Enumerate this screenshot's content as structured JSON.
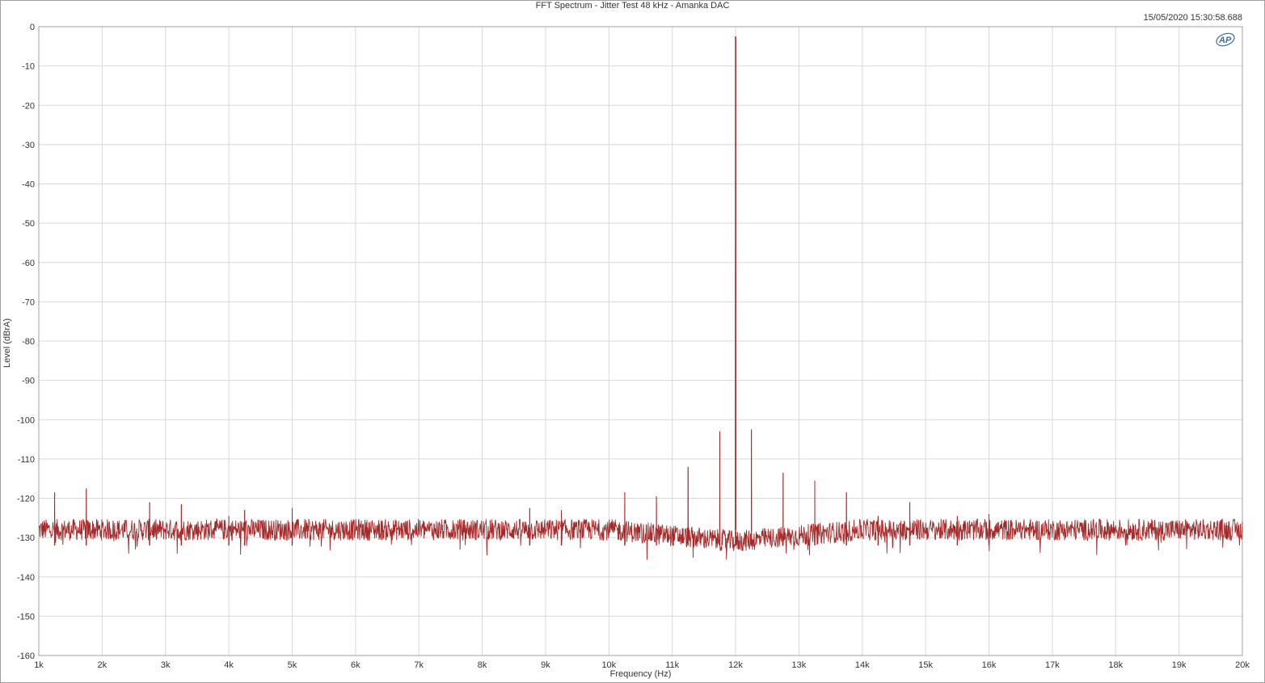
{
  "chart_data": {
    "type": "line",
    "title": "FFT Spectrum - Jitter Test 48 kHz - Amanka DAC",
    "timestamp": "15/05/2020 15:30:58.688",
    "xlabel": "Frequency (Hz)",
    "ylabel": "Level (dBrA)",
    "xlim": [
      1000,
      20000
    ],
    "ylim": [
      -160,
      0
    ],
    "x_ticks": [
      {
        "value": 1000,
        "label": "1k"
      },
      {
        "value": 2000,
        "label": "2k"
      },
      {
        "value": 3000,
        "label": "3k"
      },
      {
        "value": 4000,
        "label": "4k"
      },
      {
        "value": 5000,
        "label": "5k"
      },
      {
        "value": 6000,
        "label": "6k"
      },
      {
        "value": 7000,
        "label": "7k"
      },
      {
        "value": 8000,
        "label": "8k"
      },
      {
        "value": 9000,
        "label": "9k"
      },
      {
        "value": 10000,
        "label": "10k"
      },
      {
        "value": 11000,
        "label": "11k"
      },
      {
        "value": 12000,
        "label": "12k"
      },
      {
        "value": 13000,
        "label": "13k"
      },
      {
        "value": 14000,
        "label": "14k"
      },
      {
        "value": 15000,
        "label": "15k"
      },
      {
        "value": 16000,
        "label": "16k"
      },
      {
        "value": 17000,
        "label": "17k"
      },
      {
        "value": 18000,
        "label": "18k"
      },
      {
        "value": 19000,
        "label": "19k"
      },
      {
        "value": 20000,
        "label": "20k"
      }
    ],
    "y_ticks": [
      {
        "value": 0,
        "label": "0"
      },
      {
        "value": -10,
        "label": "-10"
      },
      {
        "value": -20,
        "label": "-20"
      },
      {
        "value": -30,
        "label": "-30"
      },
      {
        "value": -40,
        "label": "-40"
      },
      {
        "value": -50,
        "label": "-50"
      },
      {
        "value": -60,
        "label": "-60"
      },
      {
        "value": -70,
        "label": "-70"
      },
      {
        "value": -80,
        "label": "-80"
      },
      {
        "value": -90,
        "label": "-90"
      },
      {
        "value": -100,
        "label": "-100"
      },
      {
        "value": -110,
        "label": "-110"
      },
      {
        "value": -120,
        "label": "-120"
      },
      {
        "value": -130,
        "label": "-130"
      },
      {
        "value": -140,
        "label": "-140"
      },
      {
        "value": -150,
        "label": "-150"
      },
      {
        "value": -160,
        "label": "-160"
      }
    ],
    "grid": true,
    "series_color": "#a52a2a",
    "noise_floor_db": -128,
    "noise_floor_db_near_12k": -131,
    "peaks": [
      {
        "x": 1250,
        "y": -118.5
      },
      {
        "x": 1750,
        "y": -117.5
      },
      {
        "x": 2750,
        "y": -121
      },
      {
        "x": 3250,
        "y": -121.5
      },
      {
        "x": 4000,
        "y": -124.5
      },
      {
        "x": 4250,
        "y": -123
      },
      {
        "x": 5000,
        "y": -122.5
      },
      {
        "x": 8750,
        "y": -122.5
      },
      {
        "x": 9250,
        "y": -123
      },
      {
        "x": 10250,
        "y": -118.5
      },
      {
        "x": 10750,
        "y": -119.5
      },
      {
        "x": 11250,
        "y": -112
      },
      {
        "x": 11750,
        "y": -103
      },
      {
        "x": 12000,
        "y": -2.5
      },
      {
        "x": 12250,
        "y": -102.5
      },
      {
        "x": 12750,
        "y": -113.5
      },
      {
        "x": 13250,
        "y": -115.5
      },
      {
        "x": 13750,
        "y": -118.5
      },
      {
        "x": 14250,
        "y": -124.5
      },
      {
        "x": 14750,
        "y": -121
      },
      {
        "x": 15500,
        "y": -124.5
      },
      {
        "x": 16000,
        "y": -124
      }
    ]
  },
  "logo_text": "AP"
}
